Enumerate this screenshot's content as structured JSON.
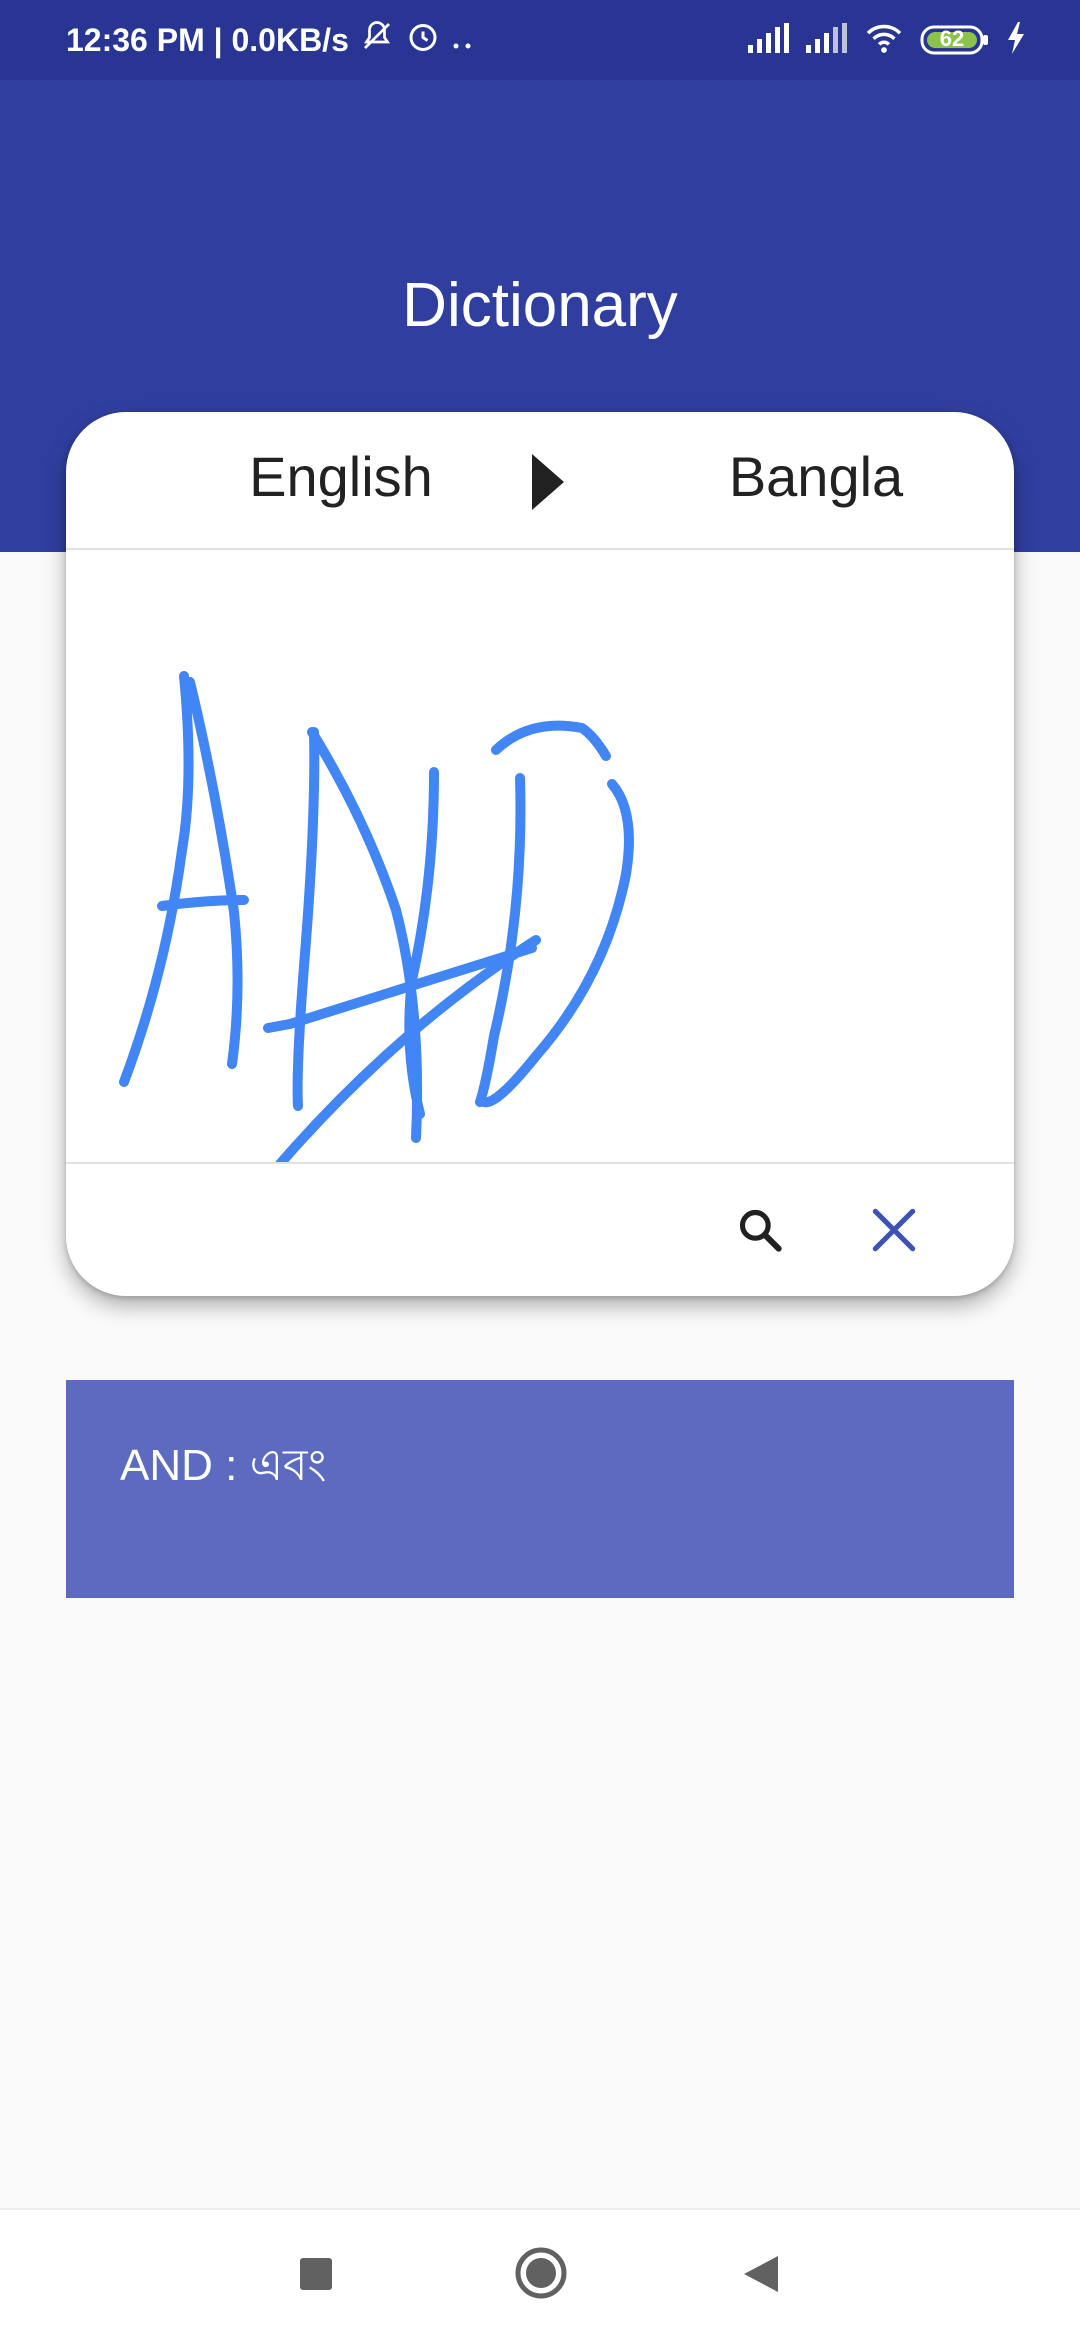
{
  "status_bar": {
    "time_speed": "12:36 PM | 0.0KB/s",
    "battery_level": "62",
    "icons": [
      "mute-icon",
      "alarm-icon",
      "more-dots-icon",
      "signal-icon",
      "signal-icon",
      "wifi-icon",
      "battery-icon",
      "charging-icon"
    ]
  },
  "app_bar": {
    "title": "Dictionary"
  },
  "translator": {
    "source_language": "English",
    "target_language": "Bangla",
    "direction_icon": "play-arrow-icon",
    "handwriting_color": "#4285f4",
    "search_icon": "search-icon",
    "clear_icon": "close-icon"
  },
  "result": {
    "text": "AND : এবং"
  },
  "nav_bar": {
    "icons": [
      "recent-apps-icon",
      "home-icon",
      "back-icon"
    ]
  },
  "colors": {
    "status_bar": "#283593",
    "primary": "#303f9f",
    "result_card": "#5c6bc0",
    "accent": "#3f51b5"
  }
}
